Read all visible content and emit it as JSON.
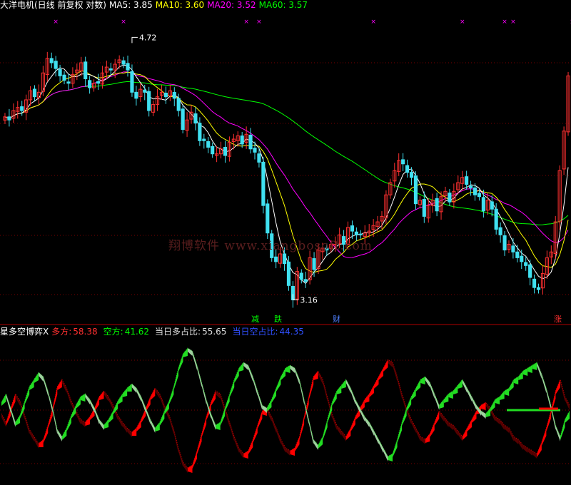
{
  "header": {
    "title": "大洋电机(日线 前复权 对数)",
    "ma": [
      {
        "label": "MA5:",
        "value": "3.85",
        "color": "#ffffff"
      },
      {
        "label": "MA10:",
        "value": "3.60",
        "color": "#ffff00"
      },
      {
        "label": "MA20:",
        "value": "3.52",
        "color": "#ff00ff"
      },
      {
        "label": "MA60:",
        "value": "3.57",
        "color": "#00ff00"
      }
    ]
  },
  "price_labels": {
    "high": "4.72",
    "low": "3.16"
  },
  "event_markers": [
    {
      "label": "减",
      "color": "#00ff00"
    },
    {
      "label": "跌",
      "color": "#00ff00"
    },
    {
      "label": "财",
      "color": "#5080ff"
    },
    {
      "label": "涨",
      "color": "#ff3030"
    }
  ],
  "watermark": "翔博软件 www.xiangbosoft.com",
  "indicator": {
    "title": "星多空博弈X",
    "fields": [
      {
        "label": "多方:",
        "value": "58.38",
        "color": "#ff3030"
      },
      {
        "label": "空方:",
        "value": "41.62",
        "color": "#00ff00"
      },
      {
        "label": "当日多占比:",
        "value": "55.65",
        "color": "#dddddd"
      },
      {
        "label": "当日空占比:",
        "value": "44.35",
        "color": "#3050ff"
      }
    ]
  },
  "colors": {
    "background": "#000000",
    "up_candle": "#ff3030",
    "down_candle": "#40e0f0",
    "grid": "#7a0000",
    "ma5": "#ffffff",
    "ma10": "#ffff00",
    "ma20": "#ff00ff",
    "ma60": "#00ff00",
    "bull_band": "#ff0000",
    "bear_band": "#22dd22",
    "bear_band_light": "#9fcf9f"
  },
  "chart_data": [
    {
      "type": "candlestick",
      "scale": "log",
      "ylim": [
        3.1,
        4.9
      ],
      "labeled_high": 4.72,
      "labeled_low": 3.16,
      "last_ma": {
        "MA5": 3.85,
        "MA10": 3.6,
        "MA20": 3.52,
        "MA60": 3.57
      },
      "close_series": [
        4.18,
        4.16,
        4.22,
        4.24,
        4.22,
        4.29,
        4.35,
        4.31,
        4.34,
        4.47,
        4.57,
        4.54,
        4.5,
        4.45,
        4.42,
        4.4,
        4.46,
        4.49,
        4.54,
        4.43,
        4.37,
        4.4,
        4.4,
        4.47,
        4.51,
        4.49,
        4.53,
        4.56,
        4.53,
        4.49,
        4.34,
        4.3,
        4.36,
        4.34,
        4.22,
        4.26,
        4.31,
        4.34,
        4.31,
        4.35,
        4.3,
        4.22,
        4.1,
        4.16,
        4.21,
        4.14,
        4.03,
        4.03,
        3.99,
        3.95,
        3.95,
        3.98,
        3.94,
        4.02,
        4.04,
        4.06,
        4.01,
        4.07,
        3.98,
        3.96,
        3.9,
        3.65,
        3.5,
        3.37,
        3.35,
        3.39,
        3.34,
        3.23,
        3.16,
        3.3,
        3.26,
        3.25,
        3.37,
        3.31,
        3.41,
        3.42,
        3.41,
        3.44,
        3.44,
        3.49,
        3.44,
        3.53,
        3.51,
        3.49,
        3.49,
        3.5,
        3.51,
        3.54,
        3.56,
        3.59,
        3.71,
        3.78,
        3.85,
        3.91,
        3.89,
        3.84,
        3.81,
        3.66,
        3.68,
        3.59,
        3.65,
        3.68,
        3.62,
        3.7,
        3.73,
        3.67,
        3.73,
        3.78,
        3.81,
        3.77,
        3.75,
        3.71,
        3.7,
        3.62,
        3.68,
        3.63,
        3.52,
        3.49,
        3.41,
        3.44,
        3.4,
        3.37,
        3.35,
        3.33,
        3.27,
        3.22,
        3.21,
        3.29,
        3.37,
        3.4,
        3.56,
        3.85,
        4.09,
        4.45
      ]
    },
    {
      "type": "area",
      "title": "星多空博弈X",
      "ylim": [
        0,
        100
      ],
      "series": [
        {
          "name": "多方",
          "last": 58.38,
          "values": [
            46,
            40,
            50,
            60,
            55,
            45,
            35,
            30,
            25,
            28,
            38,
            50,
            65,
            70,
            64,
            55,
            48,
            42,
            40,
            44,
            50,
            58,
            62,
            58,
            52,
            45,
            40,
            36,
            33,
            36,
            42,
            50,
            58,
            64,
            60,
            52,
            45,
            35,
            22,
            12,
            8,
            10,
            20,
            32,
            44,
            54,
            62,
            60,
            50,
            40,
            30,
            22,
            18,
            20,
            28,
            38,
            48,
            50,
            44,
            36,
            28,
            22,
            20,
            22,
            30,
            44,
            58,
            72,
            76,
            70,
            58,
            46,
            38,
            34,
            30,
            36,
            44,
            50,
            56,
            60,
            66,
            72,
            78,
            84,
            82,
            72,
            60,
            50,
            42,
            36,
            30,
            28,
            32,
            40,
            48,
            44,
            40,
            38,
            34,
            30,
            36,
            42,
            48,
            52,
            54,
            50,
            44,
            42,
            38,
            36,
            30,
            28,
            24,
            22,
            20,
            18,
            26,
            36,
            48,
            62,
            70,
            58,
            52
          ]
        },
        {
          "name": "空方",
          "last": 41.62,
          "values": [
            54,
            60,
            50,
            40,
            45,
            55,
            65,
            70,
            75,
            72,
            62,
            50,
            35,
            30,
            36,
            45,
            52,
            58,
            60,
            56,
            50,
            42,
            38,
            42,
            48,
            55,
            60,
            64,
            67,
            64,
            58,
            50,
            42,
            36,
            40,
            48,
            55,
            65,
            78,
            88,
            92,
            90,
            80,
            68,
            56,
            46,
            38,
            40,
            50,
            60,
            70,
            78,
            82,
            80,
            72,
            62,
            52,
            50,
            56,
            64,
            72,
            78,
            80,
            78,
            70,
            56,
            42,
            28,
            24,
            30,
            42,
            54,
            62,
            66,
            70,
            64,
            56,
            50,
            44,
            40,
            34,
            28,
            22,
            16,
            18,
            28,
            40,
            50,
            58,
            64,
            70,
            72,
            68,
            60,
            52,
            56,
            60,
            62,
            66,
            70,
            64,
            58,
            52,
            48,
            46,
            50,
            56,
            58,
            62,
            64,
            70,
            72,
            76,
            78,
            80,
            82,
            74,
            64,
            52,
            38,
            30,
            42,
            48
          ]
        }
      ]
    }
  ]
}
